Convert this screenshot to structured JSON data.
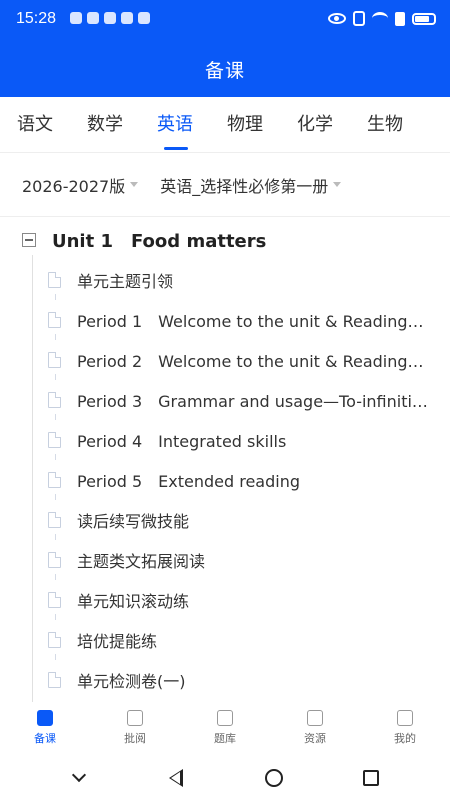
{
  "status_bar": {
    "time": "15:28"
  },
  "header": {
    "title": "备课"
  },
  "subjects": [
    {
      "label": "语文",
      "active": false
    },
    {
      "label": "数学",
      "active": false
    },
    {
      "label": "英语",
      "active": true
    },
    {
      "label": "物理",
      "active": false
    },
    {
      "label": "化学",
      "active": false
    },
    {
      "label": "生物",
      "active": false
    }
  ],
  "filters": {
    "edition": "2026-2027版",
    "book": "英语_选择性必修第一册"
  },
  "unit": {
    "title": "Unit 1　Food matters"
  },
  "items": [
    {
      "label": "单元主题引领"
    },
    {
      "label": "Period 1　Welcome to the unit & Reading…"
    },
    {
      "label": "Period 2　Welcome to the unit & Reading…"
    },
    {
      "label": "Period 3　Grammar and usage—To-infiniti…"
    },
    {
      "label": "Period 4　Integrated skills"
    },
    {
      "label": "Period 5　Extended reading"
    },
    {
      "label": "读后续写微技能"
    },
    {
      "label": "主题类文拓展阅读"
    },
    {
      "label": "单元知识滚动练"
    },
    {
      "label": "培优提能练"
    },
    {
      "label": "单元检测卷(一)"
    }
  ],
  "bottom_nav": [
    {
      "label": "备课",
      "icon": "lesson-prep-icon",
      "active": true
    },
    {
      "label": "批阅",
      "icon": "grading-icon",
      "active": false
    },
    {
      "label": "题库",
      "icon": "question-bank-icon",
      "active": false
    },
    {
      "label": "资源",
      "icon": "resources-icon",
      "active": false
    },
    {
      "label": "我的",
      "icon": "profile-icon",
      "active": false
    }
  ],
  "colors": {
    "accent": "#0a59f7",
    "text": "#333333",
    "muted": "#999999"
  }
}
